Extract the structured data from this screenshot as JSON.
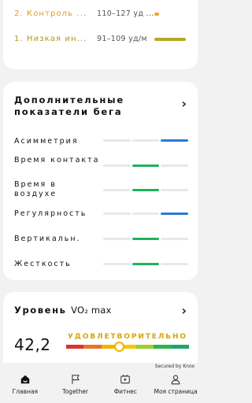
{
  "zones": [
    {
      "name": "2. Контроль ...",
      "range": "110–127 уд ...",
      "color": "#f0a030",
      "bar_fraction": 0.05
    },
    {
      "name": "1. Низкая ин...",
      "range": "91–109 уд/м",
      "color": "#b5a82a",
      "bar_fraction": 0.32
    }
  ],
  "metrics_card": {
    "title": "Дополнительные показатели бега",
    "chevron": "›",
    "metrics": [
      {
        "label": "Асимметрия",
        "segment": 3,
        "color": "blue"
      },
      {
        "label": "Время контакта",
        "segment": 2,
        "color": "green"
      },
      {
        "label": "Время в воздухе",
        "segment": 2,
        "color": "green"
      },
      {
        "label": "Регулярность",
        "segment": 3,
        "color": "blue"
      },
      {
        "label": "Вертикальн.",
        "segment": 2,
        "color": "green"
      },
      {
        "label": "Жесткость",
        "segment": 2,
        "color": "green"
      }
    ]
  },
  "vo2": {
    "title_ru": "Уровень ",
    "title_vo2": "VO₂ max",
    "chevron": "›",
    "status": "УДОВЛЕТВОРИТЕЛЬНО",
    "value": "42,2",
    "scale_colors": [
      "#d9342b",
      "#e8732a",
      "#f0b400",
      "#f5c800",
      "#9fcc2e",
      "#2fb34a",
      "#1fa56a"
    ],
    "marker_fraction": 0.43
  },
  "secured_text": "Secured by Knox",
  "nav": [
    {
      "icon": "home-icon",
      "label": "Главная"
    },
    {
      "icon": "flag-icon",
      "label": "Together"
    },
    {
      "icon": "fitness-icon",
      "label": "Фитнес"
    },
    {
      "icon": "person-icon",
      "label": "Моя страница"
    }
  ]
}
